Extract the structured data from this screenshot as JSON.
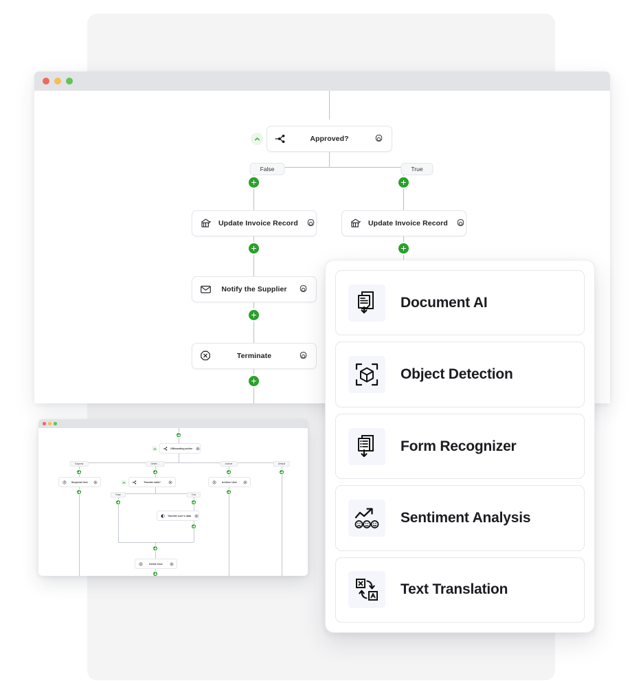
{
  "backdrop": {
    "color": "#f4f4f5"
  },
  "main_window": {
    "titlebar": {
      "buttons": [
        {
          "name": "close",
          "color": "#ed6a5f"
        },
        {
          "name": "minimize",
          "color": "#f4bf50"
        },
        {
          "name": "zoom",
          "color": "#61c454"
        }
      ]
    },
    "flow": {
      "decision_node": {
        "label": "Approved?",
        "icon": "branch-icon",
        "gear": "gear-icon",
        "collapse": "chevron-up-icon"
      },
      "branch_labels": [
        "False",
        "True"
      ],
      "left_branch_nodes": [
        {
          "label": "Update Invoice Record",
          "icon": "bank-icon",
          "gear": "gear-icon"
        },
        {
          "label": "Notify the Supplier",
          "icon": "envelope-icon",
          "gear": "gear-icon"
        },
        {
          "label": "Terminate",
          "icon": "octagon-x-icon",
          "gear": "gear-icon"
        }
      ],
      "right_branch_nodes": [
        {
          "label": "Update Invoice Record",
          "icon": "bank-icon",
          "gear": "gear-icon"
        }
      ],
      "add_button_icon": "plus-icon",
      "accent_color": "#2aa02a",
      "edge_color": "#b9bec6"
    }
  },
  "services_panel": {
    "items": [
      {
        "label": "Document AI",
        "icon": "document-ai-icon"
      },
      {
        "label": "Object Detection",
        "icon": "object-detection-icon"
      },
      {
        "label": "Form Recognizer",
        "icon": "form-recognizer-icon"
      },
      {
        "label": "Sentiment Analysis",
        "icon": "sentiment-analysis-icon"
      },
      {
        "label": "Text Translation",
        "icon": "text-translation-icon"
      }
    ],
    "icon_tile_color": "#f5f6fc"
  },
  "small_window": {
    "titlebar": {
      "buttons": [
        {
          "name": "close",
          "color": "#ed6a5f"
        },
        {
          "name": "minimize",
          "color": "#f4bf50"
        },
        {
          "name": "zoom",
          "color": "#61c454"
        }
      ]
    },
    "flow": {
      "root_node": {
        "label": "Offboarding action",
        "icon": "branch-icon"
      },
      "branch_labels": [
        "Suspend",
        "Delete ...",
        "Archive",
        "Default"
      ],
      "nodes": [
        {
          "label": "Suspend User",
          "icon": "user-icon"
        },
        {
          "label": "Transfer data?",
          "icon": "branch-icon"
        },
        {
          "label": "Archive User",
          "icon": "user-icon"
        },
        {
          "label": "Transfer user's data",
          "icon": "drive-icon"
        },
        {
          "label": "Delete User",
          "icon": "user-icon"
        }
      ],
      "sub_branch_labels": [
        "False",
        "True"
      ]
    }
  }
}
